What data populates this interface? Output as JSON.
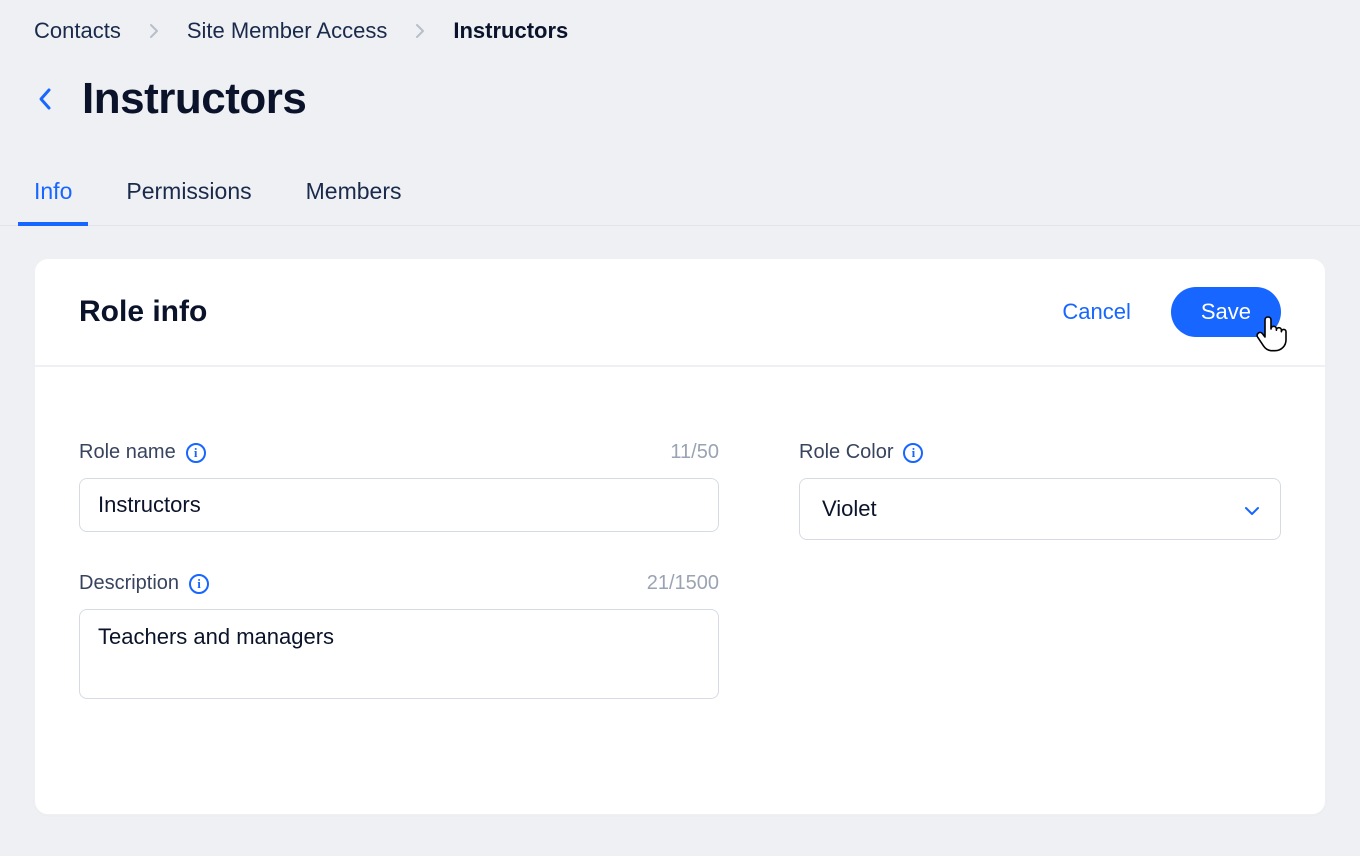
{
  "breadcrumb": {
    "items": [
      "Contacts",
      "Site Member Access",
      "Instructors"
    ]
  },
  "page": {
    "title": "Instructors"
  },
  "tabs": [
    {
      "label": "Info",
      "active": true
    },
    {
      "label": "Permissions",
      "active": false
    },
    {
      "label": "Members",
      "active": false
    }
  ],
  "card": {
    "heading": "Role info",
    "actions": {
      "cancel": "Cancel",
      "save": "Save"
    }
  },
  "form": {
    "role_name": {
      "label": "Role name",
      "value": "Instructors",
      "counter": "11/50"
    },
    "description": {
      "label": "Description",
      "value": "Teachers and managers",
      "counter": "21/1500"
    },
    "role_color": {
      "label": "Role Color",
      "value": "Violet"
    }
  },
  "colors": {
    "accent": "#1766ff",
    "text": "#0b132b",
    "muted": "#9aa3b3",
    "border": "#d6dbe3",
    "bg": "#eef0f4"
  }
}
